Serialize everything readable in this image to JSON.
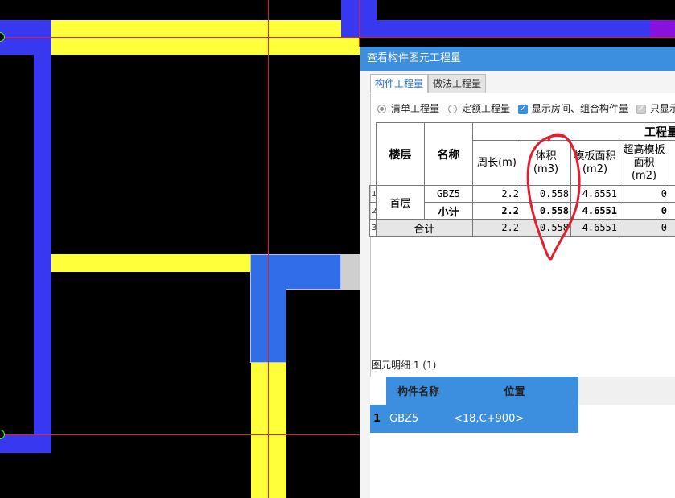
{
  "dialog": {
    "title": "查看构件图元工程量",
    "tabs": [
      "构件工程量",
      "做法工程量"
    ],
    "options": {
      "radio_list": "清单工程量",
      "radio_quota": "定额工程量",
      "check_show_rooms": "显示房间、组合构件量",
      "check_show_std": "只显示"
    },
    "table": {
      "group_header": "工程量",
      "headers": {
        "floor": "楼层",
        "name": "名称",
        "perimeter": "周长(m)",
        "volume": "体积(m3)",
        "formwork_area": "模板面积(m2)",
        "super_high_formwork": "超高模板面积(m2)"
      },
      "rows": [
        {
          "num": "1",
          "floor": "首层",
          "name": "GBZ5",
          "perimeter": "2.2",
          "volume": "0.558",
          "formwork_area": "4.6551",
          "super_high": "0"
        },
        {
          "num": "2",
          "name": "小计",
          "perimeter": "2.2",
          "volume": "0.558",
          "formwork_area": "4.6551",
          "super_high": "0"
        },
        {
          "num": "3",
          "name": "合计",
          "perimeter": "2.2",
          "volume": "0.558",
          "formwork_area": "4.6551",
          "super_high": "0"
        }
      ]
    },
    "detail": {
      "label": "图元明细  1 (1)",
      "headers": [
        "构件名称",
        "位置"
      ],
      "rows": [
        {
          "num": "1",
          "name": "GBZ5",
          "position": "<18,C+900>"
        }
      ]
    }
  },
  "colors": {
    "wall_blue": "#3838f0",
    "beam_yellow": "#ffff3a",
    "axis_red": "#e02030",
    "titlebar": "#3c8ede",
    "annotation": "#e02030"
  }
}
